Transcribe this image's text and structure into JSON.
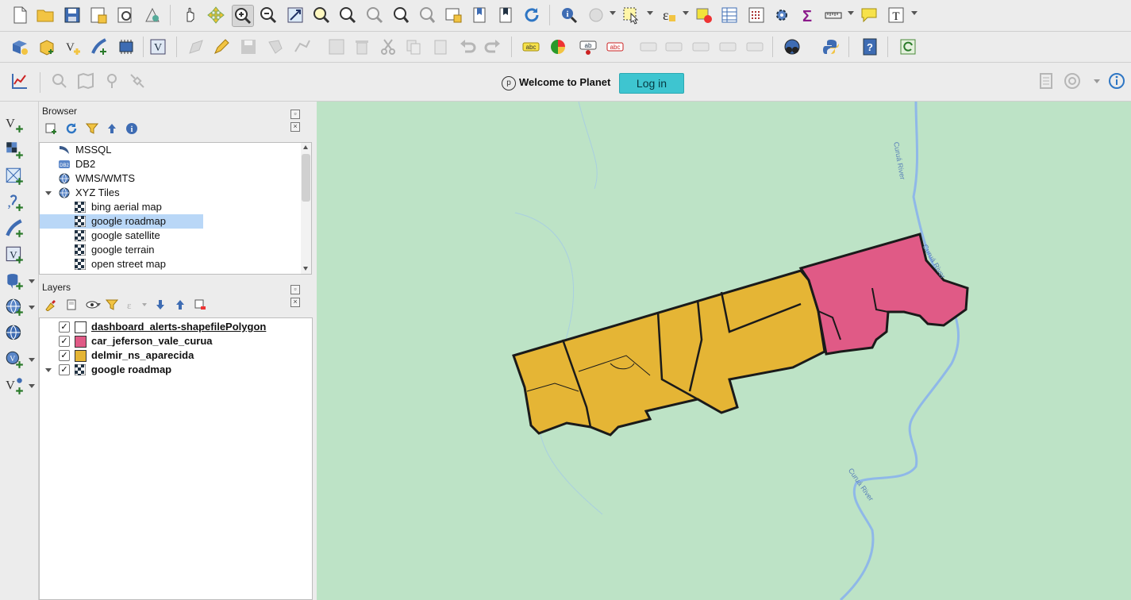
{
  "colors": {
    "map_bg": "#bde3c6",
    "car_fill": "#e05a86",
    "delmir_fill": "#e5b535",
    "river": "#8fb8e8",
    "accent_login": "#3ec5d0"
  },
  "planet": {
    "welcome": "Welcome to Planet",
    "login_label": "Log in"
  },
  "browser": {
    "title": "Browser",
    "items": [
      {
        "label": "MSSQL",
        "icon": "mssql-icon"
      },
      {
        "label": "DB2",
        "icon": "db2-icon"
      },
      {
        "label": "WMS/WMTS",
        "icon": "globe-icon"
      },
      {
        "label": "XYZ Tiles",
        "icon": "globe-icon"
      },
      {
        "label": "bing aerial map",
        "icon": "tile-icon"
      },
      {
        "label": "google roadmap",
        "icon": "tile-icon"
      },
      {
        "label": "google satellite",
        "icon": "tile-icon"
      },
      {
        "label": "google terrain",
        "icon": "tile-icon"
      },
      {
        "label": "open street map",
        "icon": "tile-icon"
      }
    ]
  },
  "layers": {
    "title": "Layers",
    "items": [
      {
        "label": "dashboard_alerts-shapefilePolygon",
        "checked": true,
        "swatch": "#ffffff"
      },
      {
        "label": "car_jeferson_vale_curua",
        "checked": true,
        "swatch": "#e05a86"
      },
      {
        "label": "delmir_ns_aparecida",
        "checked": true,
        "swatch": "#e5b535"
      },
      {
        "label": "google roadmap",
        "checked": true,
        "swatch": "tile"
      }
    ]
  },
  "map": {
    "river_labels": [
      "Curuá River",
      "Curuá River",
      "Curuá River"
    ]
  }
}
